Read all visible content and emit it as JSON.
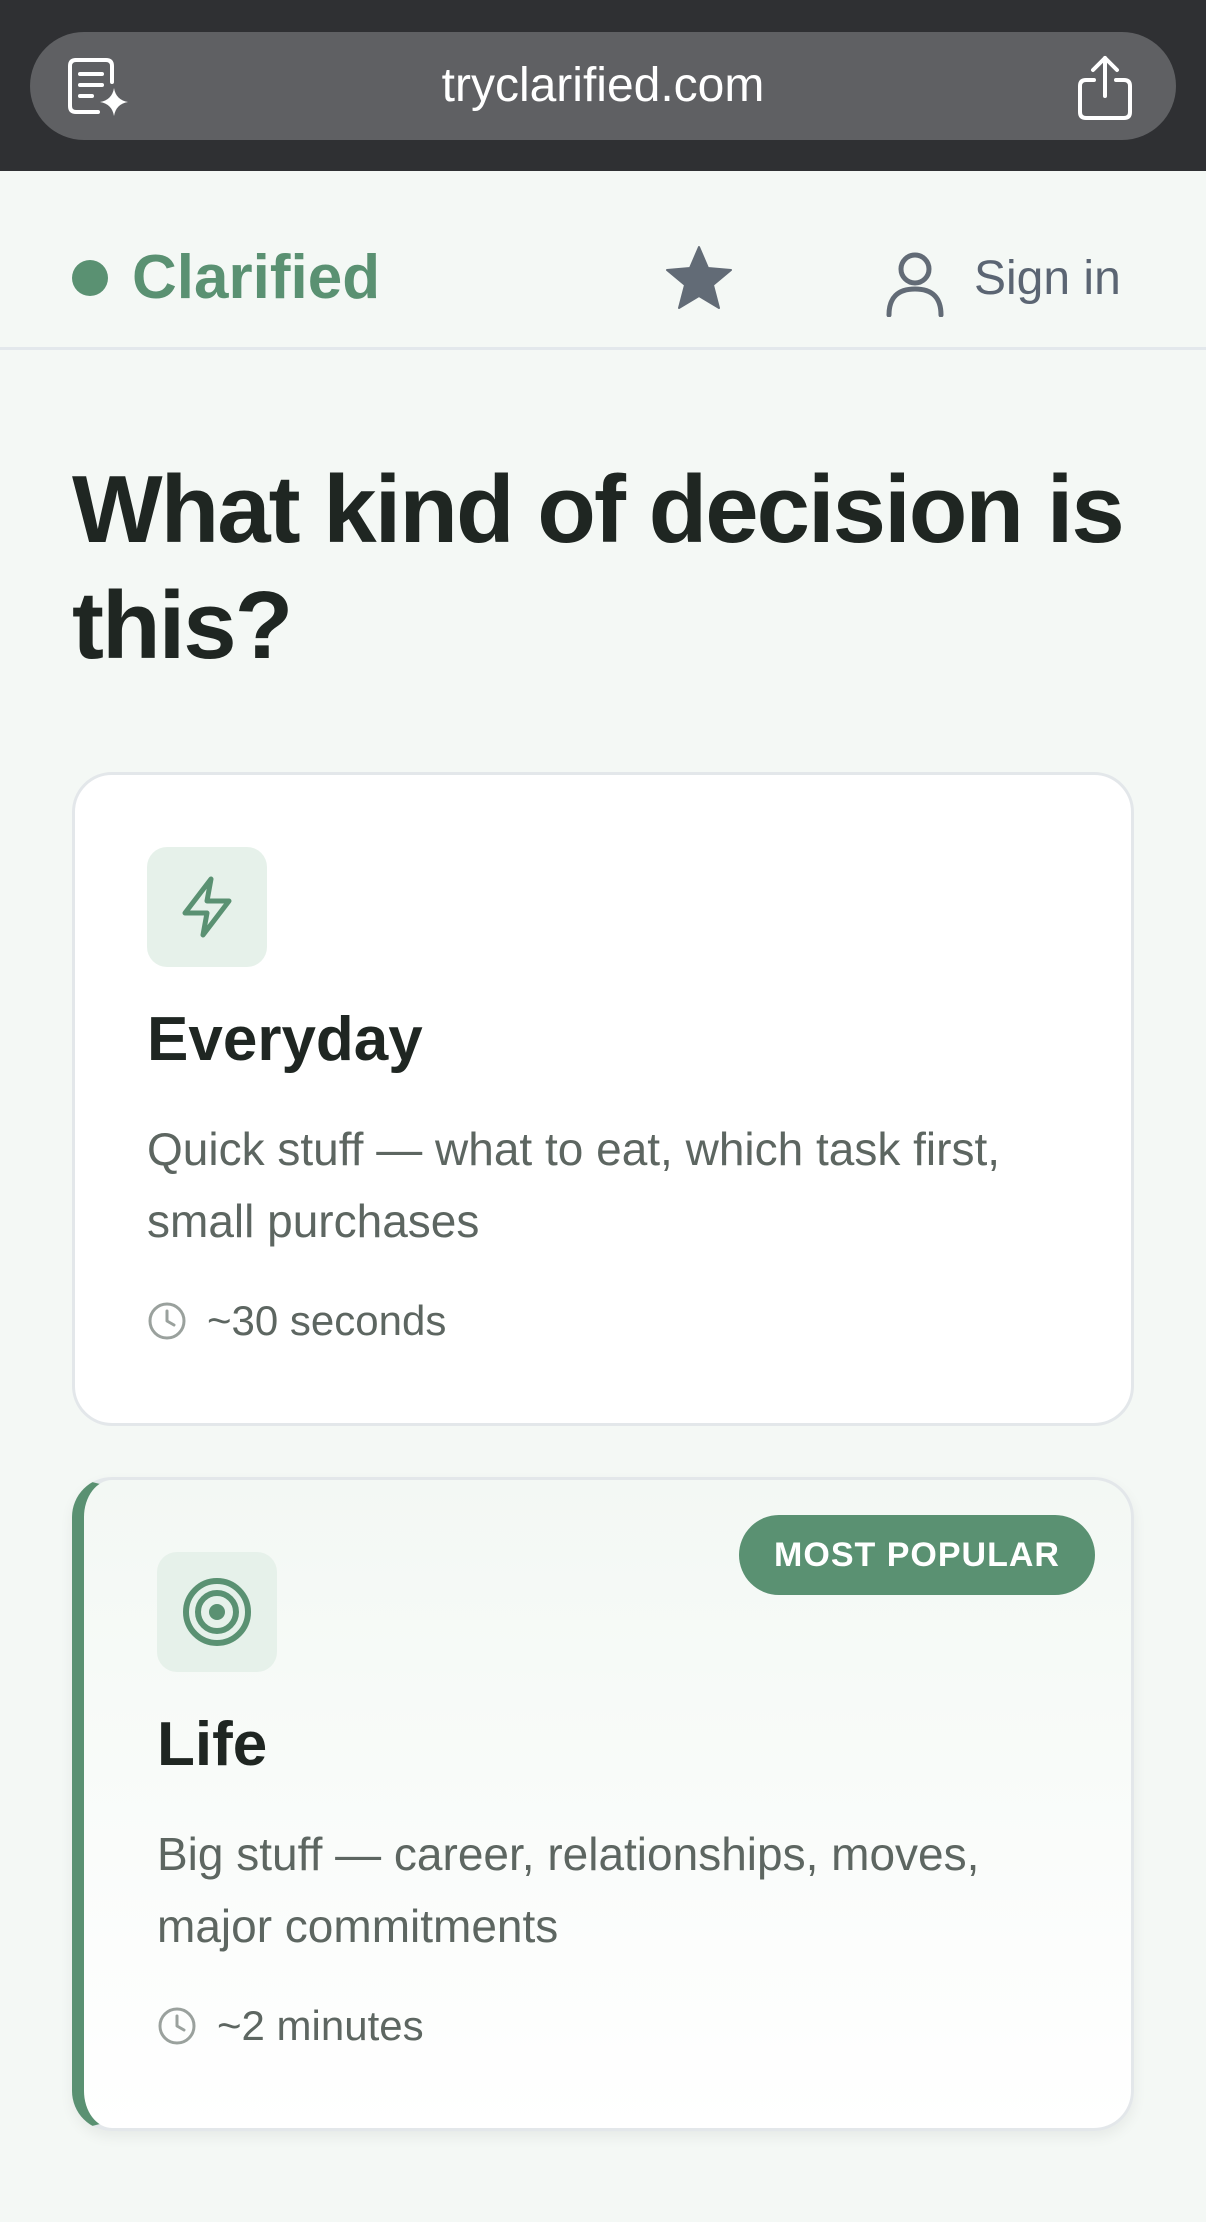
{
  "browser": {
    "url": "tryclarified.com"
  },
  "header": {
    "brand_name": "Clarified",
    "sign_in_label": "Sign in"
  },
  "main": {
    "title": "What kind of decision is this?",
    "cards": [
      {
        "title": "Everyday",
        "description": "Quick stuff — what to eat, which task first, small purchases",
        "time": "~30 seconds",
        "icon": "lightning-icon"
      },
      {
        "title": "Life",
        "description": "Big stuff — career, relationships, moves, major commitments",
        "time": "~2 minutes",
        "icon": "target-icon",
        "badge": "MOST POPULAR"
      }
    ]
  },
  "colors": {
    "brand": "#5a9172",
    "page_background": "#f4f8f5",
    "icon_box": "#e6f1ea",
    "browser_chrome": "#2f3033"
  }
}
